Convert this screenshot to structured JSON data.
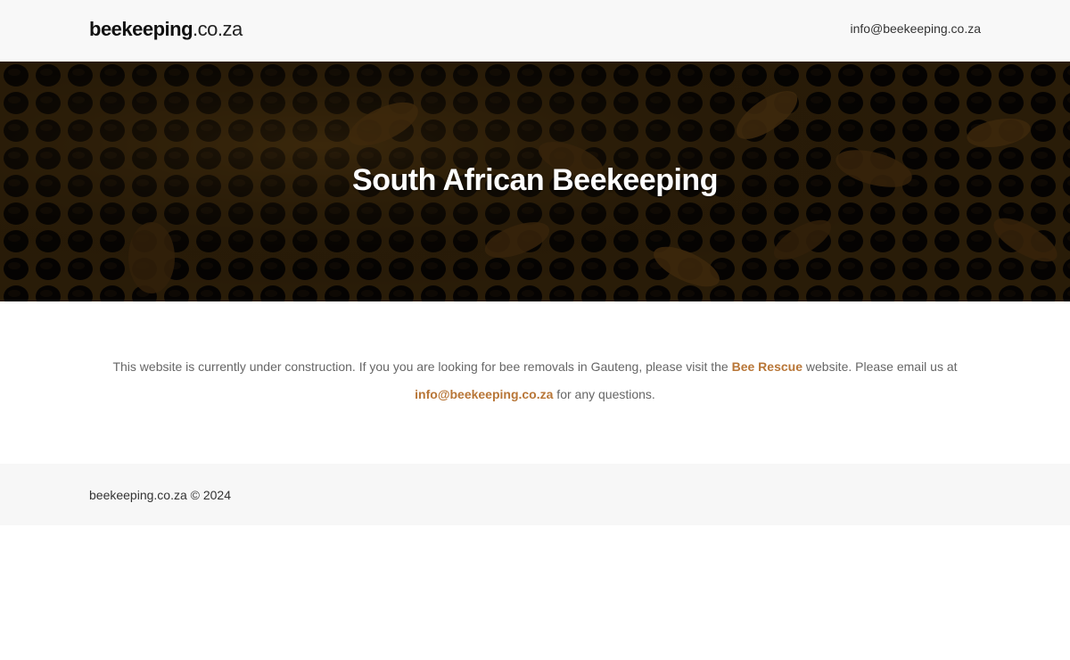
{
  "header": {
    "logo": {
      "bold": "beekeeping",
      "light": ".co.za"
    },
    "email": "info@beekeeping.co.za"
  },
  "hero": {
    "title": "South African Beekeeping"
  },
  "content": {
    "text_1": "This website is currently under construction. If you you are looking for bee removals in Gauteng, please visit the ",
    "link_bee_rescue": "Bee Rescue",
    "text_2": " website. Please email us at ",
    "link_email": "info@beekeeping.co.za",
    "text_3": " for any questions."
  },
  "footer": {
    "copyright": "beekeeping.co.za © 2024"
  },
  "colors": {
    "accent": "#b87637",
    "header_bg": "#f8f8f8",
    "footer_bg": "#f7f7f7",
    "body_text": "#666666"
  }
}
